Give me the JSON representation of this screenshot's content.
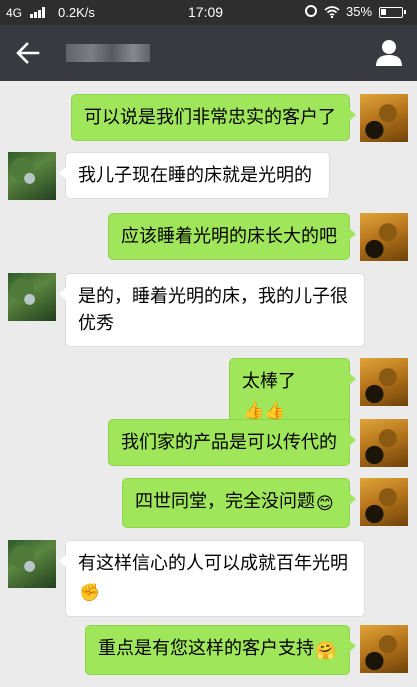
{
  "status_bar": {
    "network": "4G",
    "speed": "0.2K/s",
    "time": "17:09",
    "battery": "35%"
  },
  "header": {
    "contact_name": "",
    "icons": [
      "back-arrow-icon",
      "person-icon"
    ]
  },
  "messages": [
    {
      "from": "me",
      "text": "可以说是我们非常忠实的客户了"
    },
    {
      "from": "them",
      "text": "我儿子现在睡的床就是光明的"
    },
    {
      "from": "me",
      "text": "应该睡着光明的床长大的吧"
    },
    {
      "from": "them",
      "text": "是的，睡着光明的床，我的儿子很优秀"
    },
    {
      "from": "me",
      "text": "太棒了",
      "emoji": "👍👍"
    },
    {
      "from": "me",
      "text": "我们家的产品是可以传代的"
    },
    {
      "from": "me",
      "text": "四世同堂，完全没问题",
      "emoji": "😊"
    },
    {
      "from": "them",
      "text": "有这样信心的人可以成就百年光明",
      "emoji": "✊"
    },
    {
      "from": "me",
      "text": "重点是有您这样的客户支持",
      "emoji": "🤗"
    }
  ],
  "colors": {
    "status_bar": "#2e2e2e",
    "title_bar": "#393a3f",
    "chat_background": "#ebebeb",
    "outgoing_bubble": "#9fe65a",
    "incoming_bubble": "#ffffff"
  }
}
